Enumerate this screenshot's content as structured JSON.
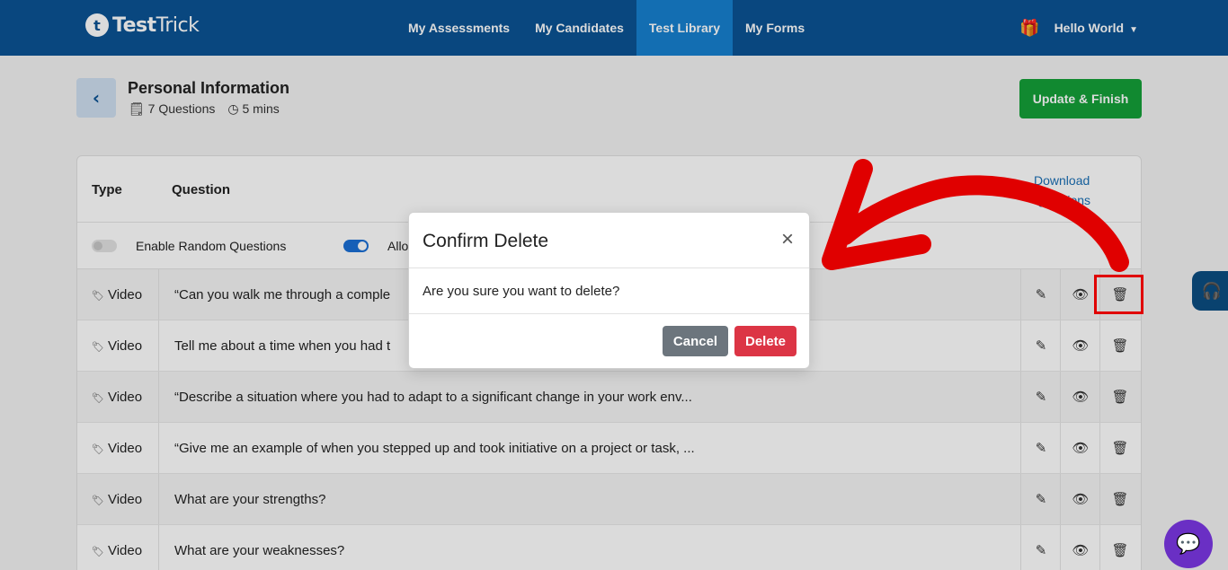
{
  "nav": {
    "logo_mark": "t",
    "logo_bold": "Test",
    "logo_light": "Trick",
    "links": [
      {
        "label": "My Assessments"
      },
      {
        "label": "My Candidates"
      },
      {
        "label": "Test Library",
        "active": true
      },
      {
        "label": "My Forms"
      }
    ],
    "user_label": "Hello World",
    "gift_icon": "gift-icon",
    "accent_color": "#0b5394"
  },
  "header": {
    "back_icon": "‹",
    "title": "Personal Information",
    "questions_count": "7 Questions",
    "duration": "5 mins",
    "update_button": "Update & Finish"
  },
  "table": {
    "col_type": "Type",
    "col_question": "Question",
    "download_link": "Download Questions",
    "option_random": "Enable Random Questions",
    "option_allow": "Allo",
    "rows": [
      {
        "type": "Video",
        "question": "“Can you walk me through a comple"
      },
      {
        "type": "Video",
        "question": "Tell me about a time when you had t"
      },
      {
        "type": "Video",
        "question": "“Describe a situation where you had to adapt to a significant change in your work env..."
      },
      {
        "type": "Video",
        "question": "“Give me an example of when you stepped up and took initiative on a project or task, ..."
      },
      {
        "type": "Video",
        "question": "What are your strengths?"
      },
      {
        "type": "Video",
        "question": "What are your weaknesses?"
      }
    ]
  },
  "modal": {
    "title": "Confirm Delete",
    "body": "Are you sure you want to delete?",
    "cancel": "Cancel",
    "delete": "Delete",
    "close_icon": "×"
  },
  "colors": {
    "success": "#14a038",
    "danger": "#dc3545",
    "secondary": "#6c757d",
    "annotation": "#e00000"
  }
}
